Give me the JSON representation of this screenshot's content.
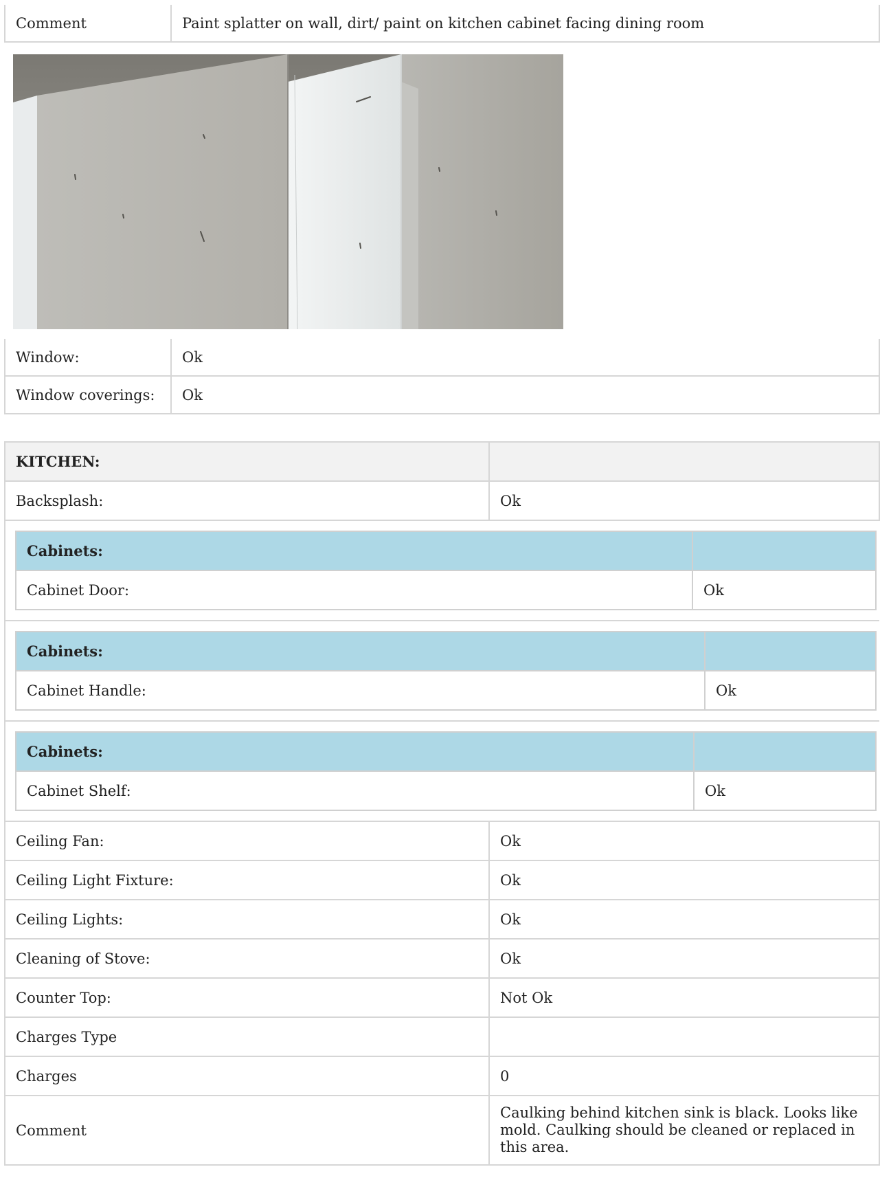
{
  "top_comment": {
    "label": "Comment",
    "value": "Paint splatter on wall, dirt/ paint on kitchen cabinet facing dining room"
  },
  "room_items": [
    {
      "label": "Window:",
      "value": "Ok"
    },
    {
      "label": "Window coverings:",
      "value": "Ok"
    }
  ],
  "kitchen": {
    "title": "KITCHEN:",
    "backsplash": {
      "label": "Backsplash:",
      "value": "Ok"
    },
    "cabinet_groups": [
      {
        "title": "Cabinets:",
        "label": "Cabinet Door:",
        "value": "Ok"
      },
      {
        "title": "Cabinets:",
        "label": "Cabinet Handle:",
        "value": "Ok"
      },
      {
        "title": "Cabinets:",
        "label": "Cabinet Shelf:",
        "value": "Ok"
      }
    ],
    "items": [
      {
        "label": "Ceiling Fan:",
        "value": "Ok"
      },
      {
        "label": "Ceiling Light Fixture:",
        "value": "Ok"
      },
      {
        "label": "Ceiling Lights:",
        "value": "Ok"
      },
      {
        "label": "Cleaning of Stove:",
        "value": "Ok"
      },
      {
        "label": "Counter Top:",
        "value": "Not Ok"
      },
      {
        "label": "Charges Type",
        "value": ""
      },
      {
        "label": "Charges",
        "value": "0"
      },
      {
        "label": "Comment",
        "value": "Caulking behind kitchen sink is black. Looks like mold. Caulking should be cleaned or replaced in this area."
      }
    ]
  }
}
